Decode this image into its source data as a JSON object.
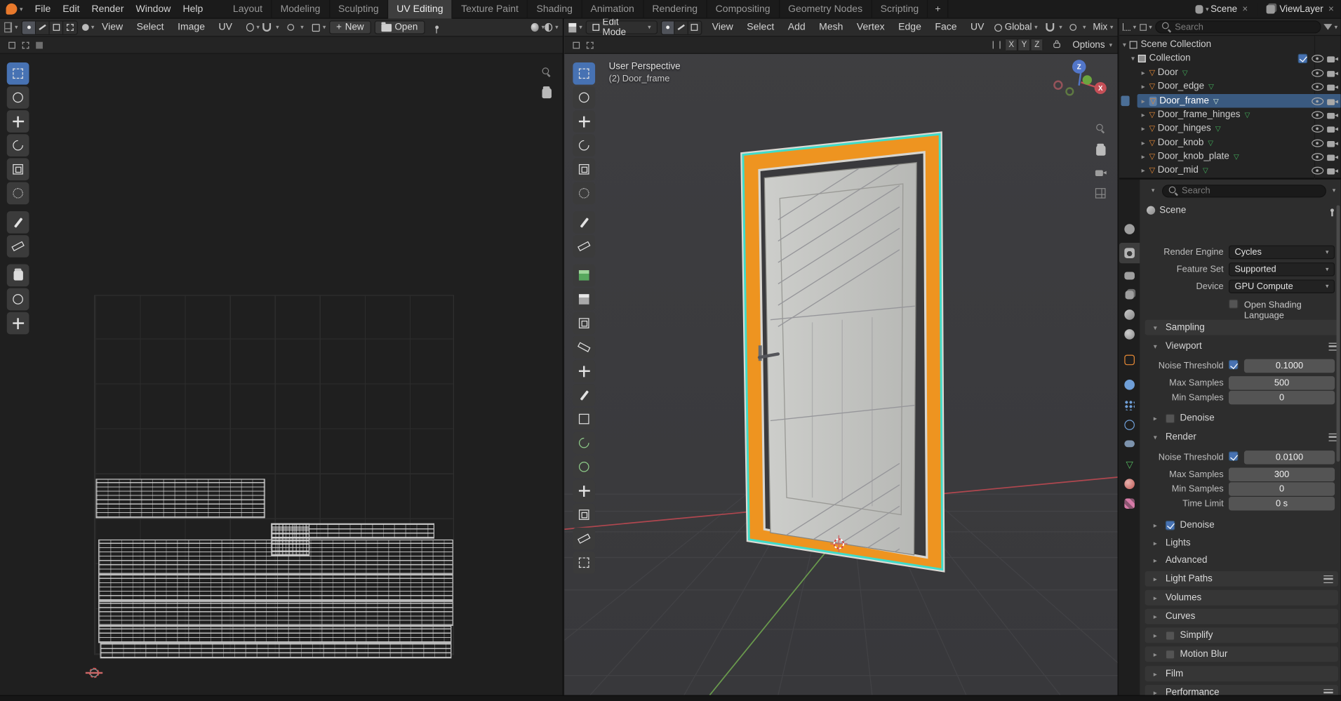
{
  "topbar": {
    "menus": [
      {
        "label": "File"
      },
      {
        "label": "Edit"
      },
      {
        "label": "Render"
      },
      {
        "label": "Window"
      },
      {
        "label": "Help"
      }
    ],
    "workspaces": [
      {
        "label": "Layout"
      },
      {
        "label": "Modeling"
      },
      {
        "label": "Sculpting"
      },
      {
        "label": "UV Editing"
      },
      {
        "label": "Texture Paint"
      },
      {
        "label": "Shading"
      },
      {
        "label": "Animation"
      },
      {
        "label": "Rendering"
      },
      {
        "label": "Compositing"
      },
      {
        "label": "Geometry Nodes"
      },
      {
        "label": "Scripting"
      }
    ],
    "active_workspace": "UV Editing",
    "add_workspace_label": "+",
    "scene_label": "Scene",
    "view_layer_label": "ViewLayer",
    "close_glyph": "×"
  },
  "uv_editor": {
    "menus": [
      {
        "label": "View"
      },
      {
        "label": "Select"
      },
      {
        "label": "Image"
      },
      {
        "label": "UV"
      }
    ],
    "new_button_label": "New",
    "new_plus_glyph": "+",
    "open_button_label": "Open"
  },
  "viewport": {
    "mode_label": "Edit Mode",
    "menus": [
      {
        "label": "View"
      },
      {
        "label": "Select"
      },
      {
        "label": "Add"
      },
      {
        "label": "Mesh"
      },
      {
        "label": "Vertex"
      },
      {
        "label": "Edge"
      },
      {
        "label": "Face"
      },
      {
        "label": "UV"
      }
    ],
    "orientation_label": "Global",
    "mix_label": "Mix",
    "options_label": "Options",
    "mirror_axes": {
      "x": "X",
      "y": "Y",
      "z": "Z"
    },
    "overlay": {
      "perspective": "User Perspective",
      "active_object": "(2) Door_frame"
    },
    "gizmo": {
      "x": "X",
      "y": "Y",
      "z": "Z"
    }
  },
  "outliner": {
    "search_placeholder": "Search",
    "scene_collection_label": "Scene Collection",
    "collection_label": "Collection",
    "objects": [
      {
        "name": "Door"
      },
      {
        "name": "Door_edge"
      },
      {
        "name": "Door_frame"
      },
      {
        "name": "Door_frame_hinges"
      },
      {
        "name": "Door_hinges"
      },
      {
        "name": "Door_knob"
      },
      {
        "name": "Door_knob_plate"
      },
      {
        "name": "Door_mid"
      }
    ],
    "selected_object": "Door_frame"
  },
  "properties": {
    "search_placeholder": "Search",
    "breadcrumb_label": "Scene",
    "fields": {
      "render_engine_label": "Render Engine",
      "render_engine_value": "Cycles",
      "feature_set_label": "Feature Set",
      "feature_set_value": "Supported",
      "device_label": "Device",
      "device_value": "GPU Compute",
      "osl_label": "Open Shading Language"
    },
    "sampling": {
      "title": "Sampling",
      "viewport": {
        "title": "Viewport",
        "noise_threshold_label": "Noise Threshold",
        "noise_threshold_value": "0.1000",
        "max_samples_label": "Max Samples",
        "max_samples_value": "500",
        "min_samples_label": "Min Samples",
        "min_samples_value": "0",
        "denoise_label": "Denoise"
      },
      "render": {
        "title": "Render",
        "noise_threshold_label": "Noise Threshold",
        "noise_threshold_value": "0.0100",
        "max_samples_label": "Max Samples",
        "max_samples_value": "300",
        "min_samples_label": "Min Samples",
        "min_samples_value": "0",
        "time_limit_label": "Time Limit",
        "time_limit_value": "0 s"
      },
      "denoise_label": "Denoise",
      "lights_label": "Lights",
      "advanced_label": "Advanced"
    },
    "sections": [
      {
        "label": "Light Paths"
      },
      {
        "label": "Volumes"
      },
      {
        "label": "Curves"
      },
      {
        "label": "Simplify"
      },
      {
        "label": "Motion Blur"
      },
      {
        "label": "Film"
      },
      {
        "label": "Performance"
      }
    ]
  },
  "icons": {
    "caret_down": "▾",
    "caret_right": "▸",
    "mesh_triangle": "▽",
    "search": "css-magnifier",
    "eye": "css-eye",
    "camera": "css-camera"
  },
  "colors": {
    "accent_blue": "#4772b3",
    "selection_orange": "#ee9420",
    "seam_cyan": "#3fdcca",
    "mesh_icon_orange": "#e78a35",
    "data_icon_green": "#43b05c",
    "axis_x_red": "#b0474f",
    "axis_y_green": "#6a9b4d"
  }
}
